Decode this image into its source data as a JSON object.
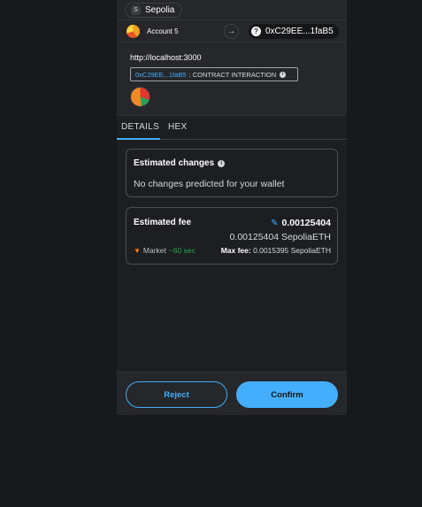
{
  "network": {
    "badge": "S",
    "name": "Sepolia"
  },
  "account": {
    "name": "Account 5",
    "arrow": "→",
    "to_badge": "?",
    "to_address": "0xC29EE...1faB5"
  },
  "request": {
    "origin": "http://localhost:3000",
    "contract_address": "0xC29EE...1faB5",
    "interaction_type": ": CONTRACT INTERACTION",
    "info_glyph": "i"
  },
  "tabs": [
    {
      "label": "DETAILS",
      "active": true
    },
    {
      "label": "HEX",
      "active": false
    }
  ],
  "estimated_changes": {
    "title": "Estimated changes",
    "info_glyph": "i",
    "text": "No changes predicted for your wallet"
  },
  "estimated_fee": {
    "title": "Estimated fee",
    "edit_icon": "✎",
    "amount": "0.00125404",
    "fiat_amount": "0.00125404 SepoliaETH",
    "fox_icon": "▼",
    "market_label": "Market",
    "speed": "~60 sec",
    "max_fee_label": "Max fee:",
    "max_fee_value": "0.0015395 SepoliaETH"
  },
  "buttons": {
    "reject": "Reject",
    "confirm": "Confirm"
  },
  "colors": {
    "accent": "#43aefc",
    "success": "#28a745",
    "background": "#17191c"
  }
}
